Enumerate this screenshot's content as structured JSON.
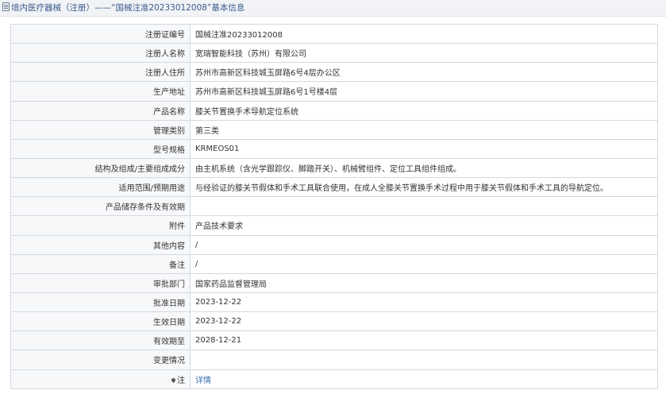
{
  "header": {
    "title": "境内医疗器械（注册）——“国械注准20233012008”基本信息"
  },
  "rows": [
    {
      "label": "注册证编号",
      "value": "国械注准20233012008"
    },
    {
      "label": "注册人名称",
      "value": "宽瑞智能科技（苏州）有限公司"
    },
    {
      "label": "注册人住所",
      "value": "苏州市高新区科技城玉屏路6号4层办公区"
    },
    {
      "label": "生产地址",
      "value": "苏州市高新区科技城玉屏路6号1号楼4层"
    },
    {
      "label": "产品名称",
      "value": "膝关节置换手术导航定位系统"
    },
    {
      "label": "管理类别",
      "value": "第三类"
    },
    {
      "label": "型号规格",
      "value": "KRMEOS01"
    },
    {
      "label": "结构及组成/主要组成成分",
      "value": "由主机系统（含光学跟踪仪、脚踏开关）、机械臂组件、定位工具组件组成。"
    },
    {
      "label": "适用范围/预期用途",
      "value": "与经验证的膝关节假体和手术工具联合使用，在成人全膝关节置换手术过程中用于膝关节假体和手术工具的导航定位。"
    },
    {
      "label": "产品储存条件及有效期",
      "value": ""
    },
    {
      "label": "附件",
      "value": "产品技术要求"
    },
    {
      "label": "其他内容",
      "value": "/"
    },
    {
      "label": "备注",
      "value": "/"
    },
    {
      "label": "审批部门",
      "value": "国家药品监督管理局"
    },
    {
      "label": "批准日期",
      "value": "2023-12-22"
    },
    {
      "label": "生效日期",
      "value": "2023-12-22"
    },
    {
      "label": "有效期至",
      "value": "2028-12-21"
    },
    {
      "label": "变更情况",
      "value": ""
    },
    {
      "label": "注",
      "value": "详情"
    }
  ],
  "icons": {
    "header_icon": "document-icon",
    "note_icon": "location-pin-icon"
  }
}
